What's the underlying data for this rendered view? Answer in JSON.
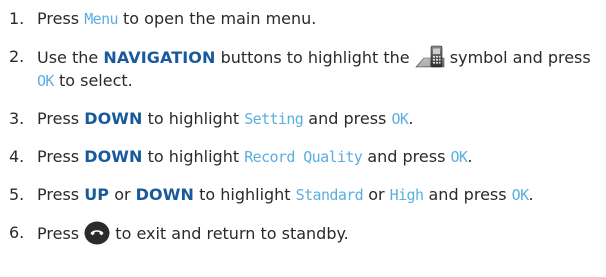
{
  "steps": [
    {
      "number": "1.",
      "t1": "Press ",
      "menu": "Menu",
      "t2": " to open the main menu."
    },
    {
      "number": "2.",
      "t1": "Use the ",
      "kw": "NAVIGATION",
      "t2": " buttons to highlight the ",
      "icon": "settings-phone-icon",
      "t3": " symbol and press ",
      "ok": "OK",
      "t4": " to select."
    },
    {
      "number": "3.",
      "t1": "Press ",
      "kw": "DOWN",
      "t2": " to highlight ",
      "item": "Setting",
      "t3": " and press ",
      "ok": "OK",
      "t4": "."
    },
    {
      "number": "4.",
      "t1": "Press ",
      "kw": "DOWN",
      "t2": " to highlight ",
      "item": "Record Quality",
      "t3": " and press ",
      "ok": "OK",
      "t4": "."
    },
    {
      "number": "5.",
      "t1": "Press ",
      "kw1": "UP",
      "t2": " or ",
      "kw2": "DOWN",
      "t3": " to highlight ",
      "item1": "Standard",
      "t4": " or ",
      "item2": "High",
      "t5": " and press ",
      "ok": "OK",
      "t6": "."
    },
    {
      "number": "6.",
      "t1": "Press ",
      "icon": "end-call-icon",
      "t2": " to exit and return to standby."
    }
  ],
  "colors": {
    "text": "#2a2a2a",
    "keyword": "#1a5a9c",
    "screen_text": "#5aaee0"
  }
}
